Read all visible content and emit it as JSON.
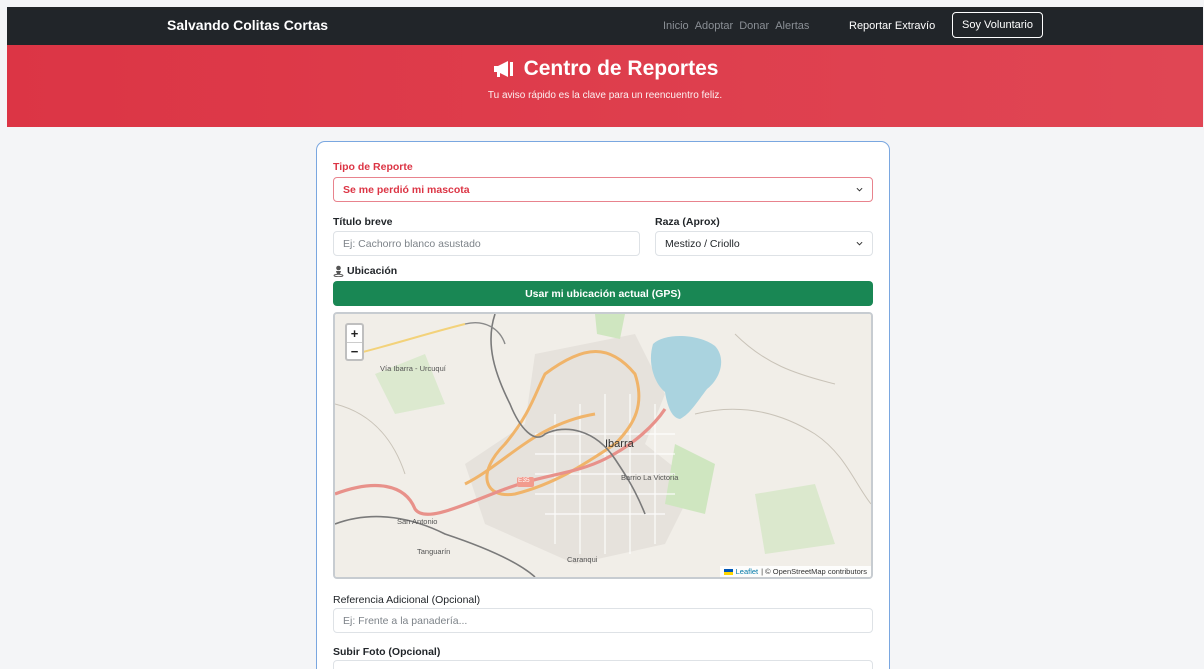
{
  "nav": {
    "brand": "Salvando Colitas Cortas",
    "links": [
      "Inicio",
      "Adoptar",
      "Donar",
      "Alertas"
    ],
    "report_link": "Reportar Extravío",
    "volunteer_button": "Soy Voluntario"
  },
  "hero": {
    "title": "Centro de Reportes",
    "subtitle": "Tu aviso rápido es la clave para un reencuentro feliz."
  },
  "form": {
    "tipo_label": "Tipo de Reporte",
    "tipo_value": "Se me perdió mi mascota",
    "titulo_label": "Título breve",
    "titulo_placeholder": "Ej: Cachorro blanco asustado",
    "raza_label": "Raza (Aprox)",
    "raza_value": "Mestizo / Criollo",
    "ubicacion_label": "Ubicación",
    "gps_button": "Usar mi ubicación actual (GPS)",
    "referencia_label": "Referencia Adicional (Opcional)",
    "referencia_placeholder": "Ej: Frente a la panadería...",
    "foto_label": "Subir Foto (Opcional)"
  },
  "map": {
    "zoom_in": "+",
    "zoom_out": "−",
    "attribution_leaflet": "Leaflet",
    "attribution_rest": "| © OpenStreetMap contributors",
    "labels": {
      "ibarra": "Ibarra",
      "barrio": "Barrio La Victoria",
      "san_antonio": "San Antonio",
      "tanguarin": "Tanguarín",
      "caranqui": "Caranqui",
      "e35": "E35",
      "via": "Vía Ibarra - Urcuquí"
    }
  },
  "colors": {
    "navbar": "#212529",
    "hero": "#dc3545",
    "gps": "#198754",
    "card_border": "#7aa7e0"
  }
}
